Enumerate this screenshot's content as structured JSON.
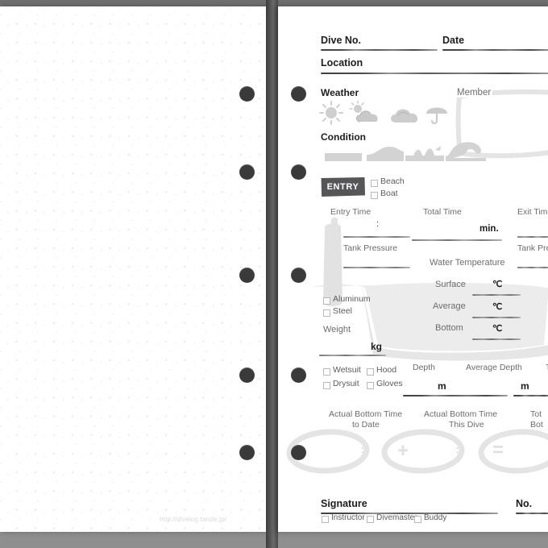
{
  "document": {
    "type": "dive-log-notebook",
    "watermark": "http://divelog.tande.jp/"
  },
  "colors": {
    "desk": "#8a8a8a",
    "page": "#ffffff",
    "spine": "#4a4a4a",
    "ring": "#3a3a3a",
    "entry_badge": "#565658",
    "illustration": "#e8e8e8",
    "text_dark": "#1d1d1f",
    "text_gray": "#58585a"
  },
  "left_page": {
    "kind": "dot-grid",
    "watermark": "http://divelog.tande.jp/"
  },
  "form": {
    "header": {
      "dive_no_label": "Dive No.",
      "date_label": "Date",
      "location_label": "Location"
    },
    "weather": {
      "label": "Weather",
      "icons": [
        "sun-icon",
        "sun-cloud-icon",
        "cloud-icon",
        "umbrella-icon"
      ]
    },
    "condition": {
      "label": "Condition",
      "icons": [
        "flat-sea-icon",
        "small-wave-icon",
        "choppy-wave-icon",
        "big-wave-icon"
      ]
    },
    "member": {
      "label": "Member"
    },
    "entry": {
      "badge": "ENTRY",
      "options": [
        "Beach",
        "Boat"
      ],
      "entry_time_label": "Entry Time",
      "entry_time_value": ":",
      "total_time_label": "Total Time",
      "total_time_unit": "min.",
      "exit_time_label": "Exit Time",
      "exit_time_value": ":",
      "tank_pressure_label": "Tank Pressure",
      "tank_pressure_label_right": "Tank Pressure"
    },
    "water_temperature": {
      "label": "Water Temperature",
      "rows": [
        {
          "label": "Surface",
          "unit": "℃"
        },
        {
          "label": "Average",
          "unit": "℃"
        },
        {
          "label": "Bottom",
          "unit": "℃"
        }
      ]
    },
    "tank": {
      "options": [
        "Aluminum",
        "Steel"
      ],
      "weight_label": "Weight",
      "weight_unit": "kg"
    },
    "suit": {
      "options": [
        "Wetsuit",
        "Hood",
        "Drysuit",
        "Gloves"
      ]
    },
    "depth": {
      "depth_label": "Depth",
      "depth_unit": "m",
      "average_depth_label": "Average Depth",
      "average_depth_unit": "m",
      "third_label": "T"
    },
    "bottom_time": {
      "col1_line1": "Actual Bottom Time",
      "col1_line2": "to Date",
      "col2_line1": "Actual Bottom Time",
      "col2_line2": "This Dive",
      "col3_line1": "Tot",
      "col3_line2": "Bot",
      "value1": ":",
      "value2": ":",
      "operator_plus": "+",
      "operator_equals": "="
    },
    "signature": {
      "label": "Signature",
      "no_label": "No.",
      "roles": [
        "Instructor",
        "Divemaster",
        "Buddy"
      ]
    }
  }
}
